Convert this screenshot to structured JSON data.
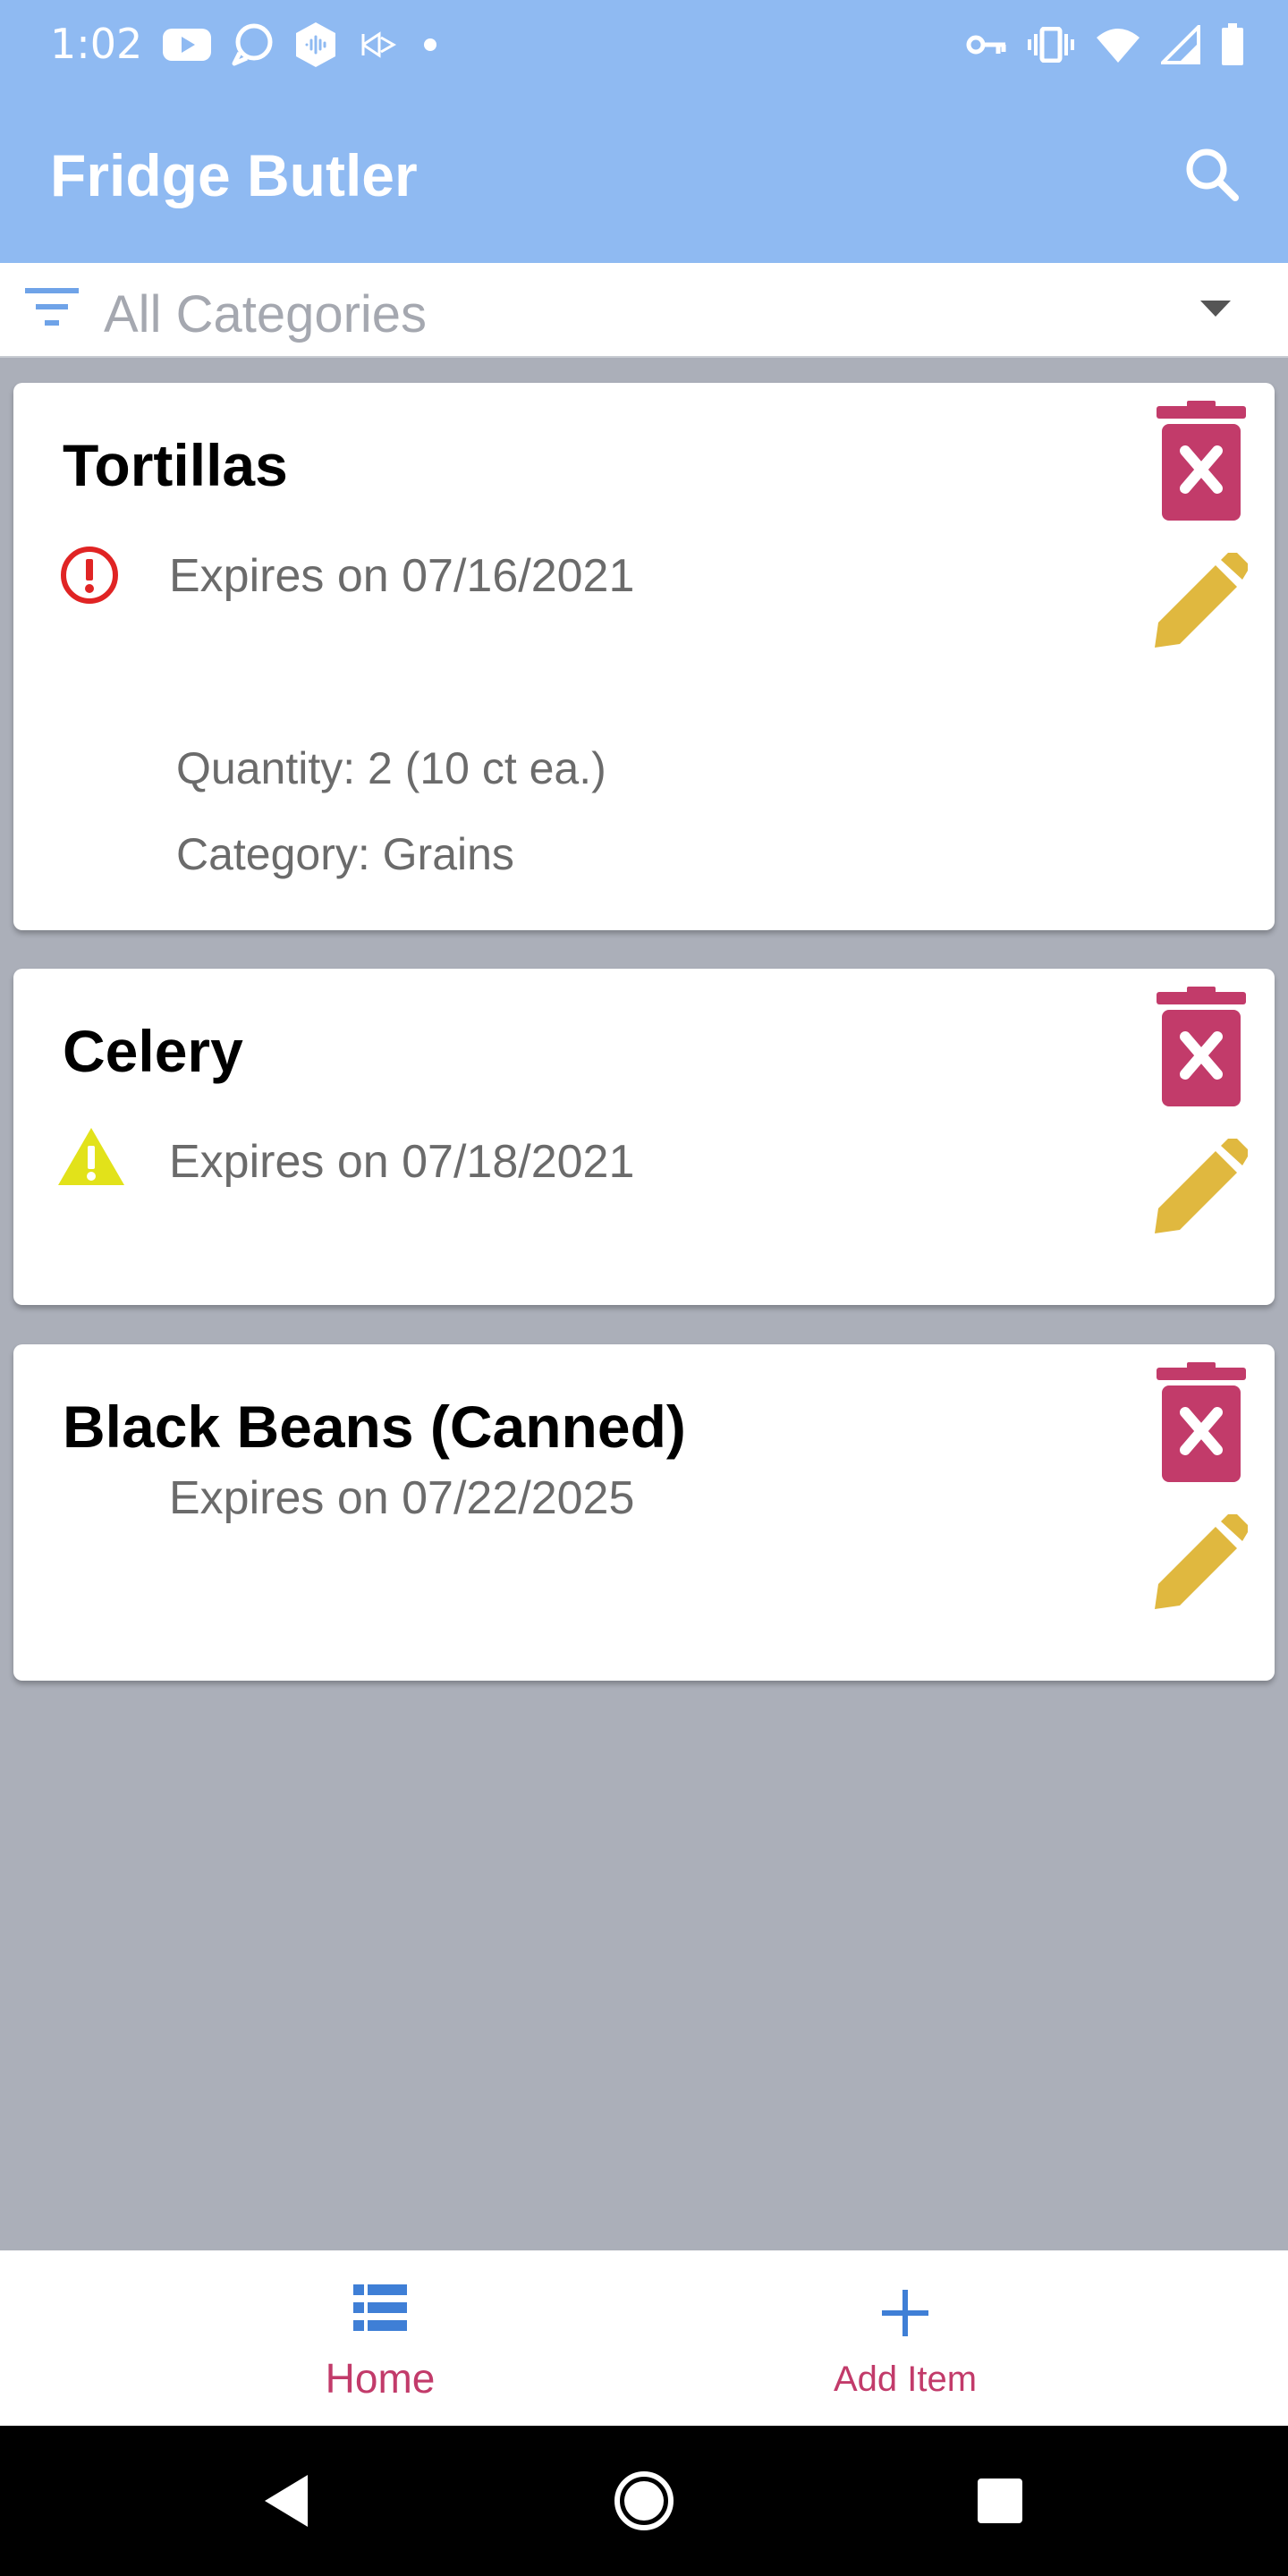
{
  "status_bar": {
    "time": "1:02",
    "left_icons": [
      "youtube-icon",
      "chat-bubble-icon",
      "audio-hex-icon",
      "cast-icon",
      "dot-icon"
    ],
    "right_icons": [
      "key-icon",
      "vibrate-icon",
      "wifi-icon",
      "signal-icon",
      "battery-icon"
    ]
  },
  "app_bar": {
    "title": "Fridge Butler",
    "search_icon": "search-icon"
  },
  "filter": {
    "selected": "All Categories",
    "icon": "filter-icon",
    "caret": "caret-down-icon"
  },
  "items": [
    {
      "name": "Tortillas",
      "status_icon": "error-icon",
      "expires": "Expires on 07/16/2021",
      "quantity": "Quantity: 2  (10 ct ea.)",
      "category": "Category: Grains"
    },
    {
      "name": "Celery",
      "status_icon": "warning-icon",
      "expires": "Expires on 07/18/2021"
    },
    {
      "name": "Black Beans (Canned)",
      "expires": "Expires on 07/22/2025"
    }
  ],
  "bottom_nav": {
    "home": "Home",
    "add_item": "Add Item"
  },
  "colors": {
    "app_bar": "#8fbaf2",
    "background": "#abafb9",
    "delete": "#c23b6a",
    "edit": "#e0b83f",
    "error": "#e02424",
    "warning": "#e2e21a",
    "nav_label": "#c23b6a",
    "nav_icon": "#3f7fd6"
  }
}
